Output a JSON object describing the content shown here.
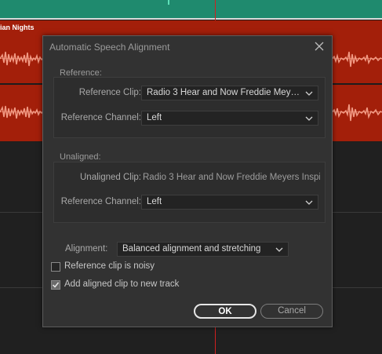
{
  "background": {
    "clip_title": "ian Nights",
    "colors": {
      "green_track": "#1f8a6e",
      "red_track": "#a31f0a",
      "waveform": "#f29a84",
      "playhead": "#d02020"
    }
  },
  "dialog": {
    "title": "Automatic Speech Alignment",
    "reference": {
      "group_label": "Reference:",
      "clip_label": "Reference Clip:",
      "clip_value": "Radio 3 Hear and Now Freddie Meyers ...",
      "channel_label": "Reference Channel:",
      "channel_value": "Left"
    },
    "unaligned": {
      "group_label": "Unaligned:",
      "clip_label": "Unaligned Clip:",
      "clip_value": "Radio 3 Hear and Now Freddie Meyers Inspi...",
      "channel_label": "Reference Channel:",
      "channel_value": "Left"
    },
    "alignment": {
      "label": "Alignment:",
      "value": "Balanced alignment and stretching"
    },
    "checkboxes": {
      "noisy_label": "Reference clip is noisy",
      "noisy_checked": false,
      "new_track_label": "Add aligned clip to new track",
      "new_track_checked": true
    },
    "buttons": {
      "ok": "OK",
      "cancel": "Cancel"
    }
  }
}
